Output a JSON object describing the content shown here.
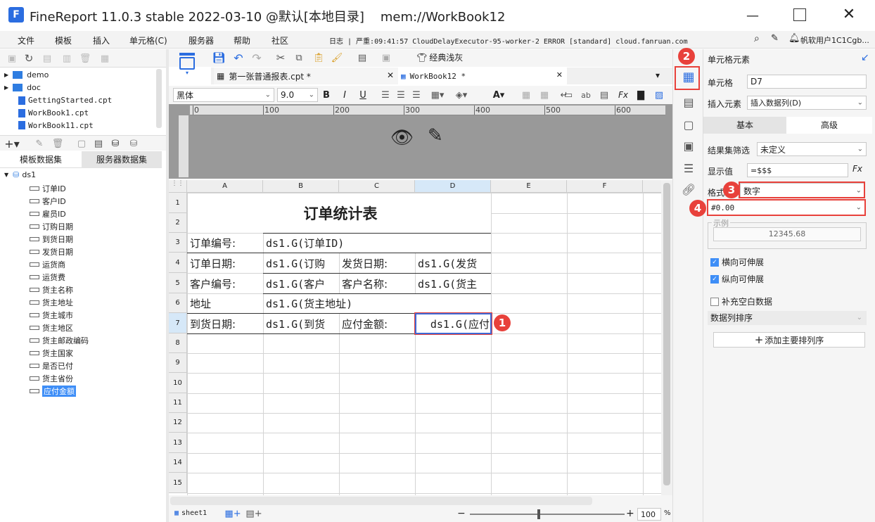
{
  "window": {
    "title": "FineReport 11.0.3 stable 2022-03-10 @默认[本地目录]    mem://WorkBook12"
  },
  "menu": {
    "items": [
      "文件",
      "模板",
      "插入",
      "单元格(C)",
      "服务器",
      "帮助",
      "社区"
    ],
    "log_text": "日志 | 严重:09:41:57 CloudDelayExecutor-95-worker-2 ERROR [standard] cloud.fanruan.com",
    "user": "帆软用户1C1Cgb..."
  },
  "file_tree": {
    "items": [
      "demo",
      "doc",
      "GettingStarted.cpt",
      "WorkBook1.cpt",
      "WorkBook11.cpt"
    ]
  },
  "dataset_tabs": {
    "template": "模板数据集",
    "server": "服务器数据集"
  },
  "dataset": {
    "name": "ds1",
    "fields": [
      "订单ID",
      "客户ID",
      "雇员ID",
      "订购日期",
      "到货日期",
      "发货日期",
      "运货商",
      "运货费",
      "货主名称",
      "货主地址",
      "货主城市",
      "货主地区",
      "货主邮政编码",
      "货主国家",
      "是否已付",
      "货主省份",
      "应付金额"
    ],
    "selected": "应付金额"
  },
  "toolbar": {
    "classic_gray": "经典浅灰"
  },
  "doc_tabs": [
    {
      "label": "第一张普通报表.cpt *"
    },
    {
      "label": "WorkBook12 *"
    }
  ],
  "format_bar": {
    "font": "黑体",
    "size": "9.0"
  },
  "ruler": {
    "marks": [
      "0",
      "100",
      "200",
      "300",
      "400",
      "500",
      "600"
    ]
  },
  "sheet": {
    "columns": [
      "A",
      "B",
      "C",
      "D",
      "E",
      "F"
    ],
    "rows": [
      "1",
      "2",
      "3",
      "4",
      "5",
      "6",
      "7",
      "8",
      "9",
      "10",
      "11",
      "12",
      "13",
      "14",
      "15"
    ],
    "title": "订单统计表",
    "cells": {
      "a3": "订单编号:",
      "b3": "ds1.G(订单ID)",
      "a4": "订单日期:",
      "b4": "ds1.G(订购",
      "c4": "发货日期:",
      "d4": "ds1.G(发货",
      "a5": "客户编号:",
      "b5": "ds1.G(客户",
      "c5": "客户名称:",
      "d5": "ds1.G(货主",
      "a6": "地址",
      "b6": "ds1.G(货主地址)",
      "a7": "到货日期:",
      "b7": "ds1.G(到货",
      "c7": "应付金额:",
      "d7": "ds1.G(应付"
    }
  },
  "bottom": {
    "sheet_tab": "sheet1",
    "zoom": "100",
    "zoom_unit": "%"
  },
  "right_panel": {
    "header": "单元格元素",
    "cell_label": "单元格",
    "cell_value": "D7",
    "insert_label": "插入元素",
    "insert_value": "插入数据列(D)",
    "tab_basic": "基本",
    "tab_advanced": "高级",
    "filter_label": "结果集筛选",
    "filter_value": "未定义",
    "display_label": "显示值",
    "display_value": "=$$$",
    "format_label": "格式",
    "format_value": "数字",
    "pattern_value": "#0.00",
    "example_label": "示例",
    "example_value": "12345.68",
    "horizontal_expand": "横向可伸展",
    "vertical_expand": "纵向可伸展",
    "fill_blank": "补充空白数据",
    "sort_label": "数据列排序",
    "add_sort": "添加主要排列序"
  },
  "badges": [
    "1",
    "2",
    "3",
    "4"
  ],
  "colors": {
    "accent": "#3e8ef7",
    "badge": "#e8413b"
  }
}
